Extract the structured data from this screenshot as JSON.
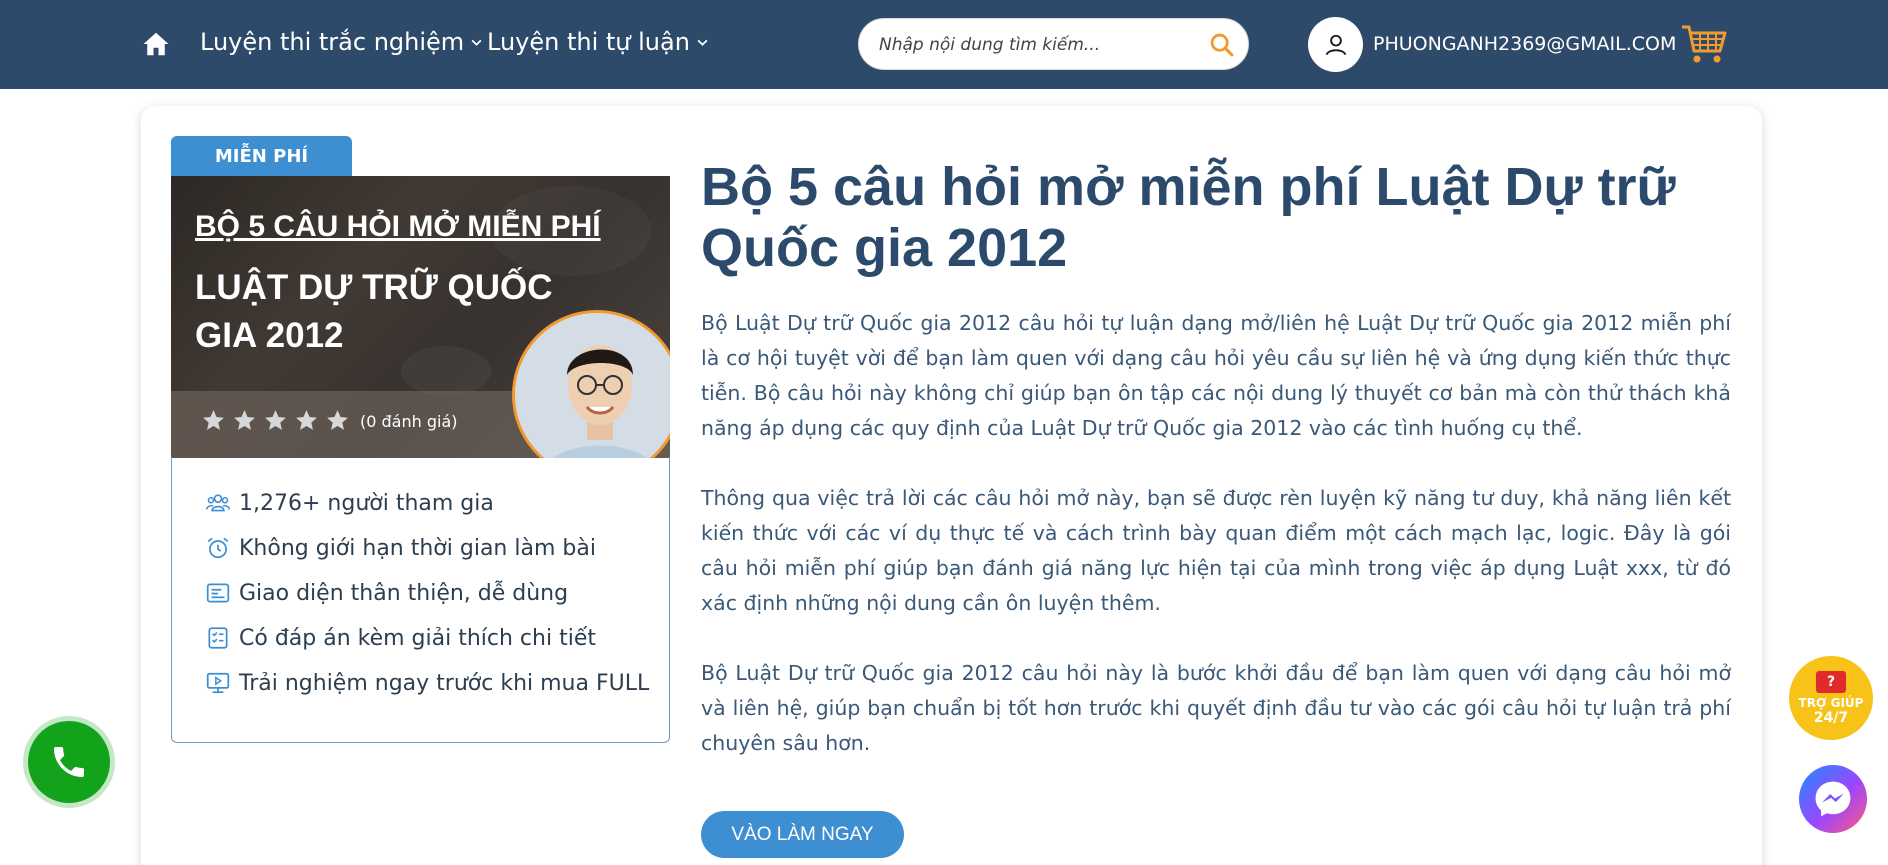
{
  "header": {
    "nav": [
      {
        "label": "Luyện thi trắc nghiệm"
      },
      {
        "label": "Luyện thi tự luận"
      }
    ],
    "search": {
      "placeholder": "Nhập nội dung tìm kiếm..."
    },
    "user_email": "PHUONGANH2369@GMAIL.COM"
  },
  "product": {
    "badge": "MIỄN PHÍ",
    "banner_title_1": "BỘ 5 CÂU HỎI MỞ MIỄN PHÍ",
    "banner_title_2": "LUẬT DỰ TRỮ QUỐC GIA 2012",
    "rating": {
      "stars": 0,
      "max": 5,
      "label": "(0 đánh giá)"
    },
    "features": [
      {
        "icon": "users-icon",
        "label": "1,276+ người tham gia"
      },
      {
        "icon": "alarm-clock-icon",
        "label": "Không giới hạn thời gian làm bài"
      },
      {
        "icon": "interface-icon",
        "label": "Giao diện thân thiện, dễ dùng"
      },
      {
        "icon": "checklist-icon",
        "label": "Có đáp án kèm giải thích chi tiết"
      },
      {
        "icon": "screen-play-icon",
        "label": "Trải nghiệm ngay trước khi mua FULL"
      }
    ]
  },
  "content": {
    "title": "Bộ 5 câu hỏi mở miễn phí Luật Dự trữ Quốc gia 2012",
    "paragraphs": [
      "Bộ Luật Dự trữ Quốc gia 2012 câu hỏi tự luận dạng mở/liên hệ Luật Dự trữ Quốc gia 2012 miễn phí là cơ hội tuyệt vời để bạn làm quen với dạng câu hỏi yêu cầu sự liên hệ và ứng dụng kiến thức thực tiễn. Bộ câu hỏi này không chỉ giúp bạn ôn tập các nội dung lý thuyết cơ bản mà còn thử thách khả năng áp dụng các quy định của Luật Dự trữ Quốc gia 2012 vào các tình huống cụ thể.",
      "Thông qua việc trả lời các câu hỏi mở này, bạn sẽ được rèn luyện kỹ năng tư duy, khả năng liên kết kiến thức với các ví dụ thực tế và cách trình bày quan điểm một cách mạch lạc, logic. Đây là gói câu hỏi miễn phí giúp bạn đánh giá năng lực hiện tại của mình trong việc áp dụng Luật xxx, từ đó xác định những nội dung cần ôn luyện thêm.",
      "Bộ Luật Dự trữ Quốc gia 2012 câu hỏi này là bước khởi đầu để bạn làm quen với dạng câu hỏi mở và liên hệ, giúp bạn chuẩn bị tốt hơn trước khi quyết định đầu tư vào các gói câu hỏi tự luận trả phí chuyên sâu hơn."
    ],
    "cta": "VÀO LÀM NGAY"
  },
  "widgets": {
    "help_line1": "TRỢ GIÚP",
    "help_line2": "24/7",
    "help_icon_text": "?"
  },
  "colors": {
    "header_bg": "#2e4a6a",
    "accent_blue": "#3d8fd1",
    "title_text": "#2c4a6b",
    "orange": "#f29a2e",
    "phone_green": "#13a31b",
    "help_yellow": "#f8c318"
  }
}
